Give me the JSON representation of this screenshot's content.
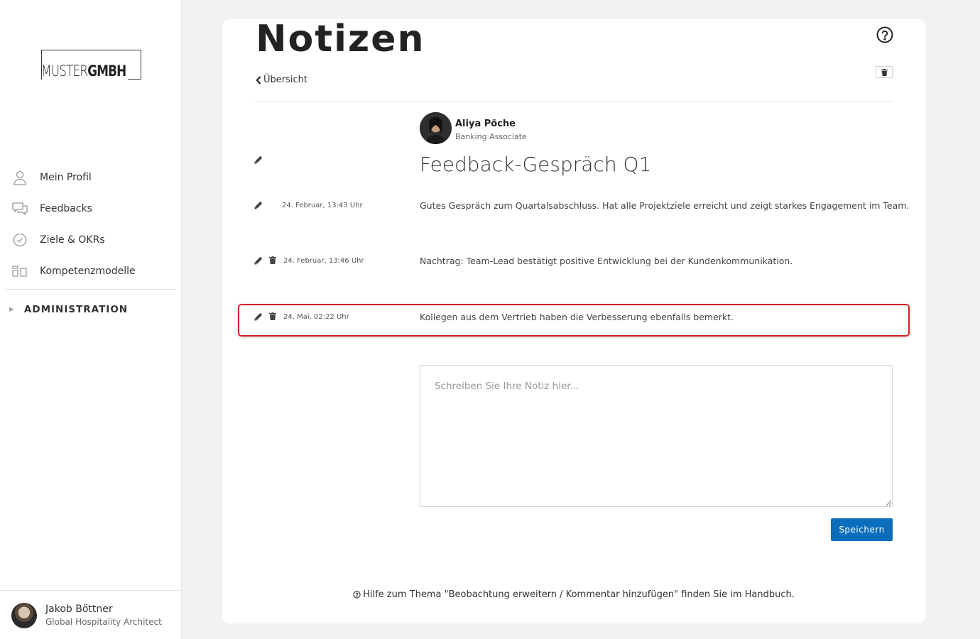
{
  "brand": {
    "logo_part1": "MUSTER",
    "logo_part2": "GMBH"
  },
  "sidebar": {
    "items": [
      {
        "label": "Mein Profil",
        "icon": "user-icon"
      },
      {
        "label": "Feedbacks",
        "icon": "chat-icon"
      },
      {
        "label": "Ziele & OKRs",
        "icon": "check-circle-icon"
      },
      {
        "label": "Kompetenzmodelle",
        "icon": "blocks-icon"
      }
    ],
    "admin_label": "ADMINISTRATION"
  },
  "current_user": {
    "name": "Jakob Böttner",
    "role": "Global Hospitality Architect"
  },
  "page": {
    "title": "Notizen",
    "back_label": "Übersicht"
  },
  "person": {
    "name": "Aliya Pöche",
    "role": "Banking Associate"
  },
  "note": {
    "title": "Feedback-Gespräch Q1",
    "entries": [
      {
        "date": "24. Februar, 13:43 Uhr",
        "text": "Gutes Gespräch zum Quartalsabschluss. Hat alle Projektziele erreicht und zeigt starkes Engagement im Team.",
        "deletable": false
      },
      {
        "date": "24. Februar, 13:46 Uhr",
        "text": "Nachtrag: Team-Lead bestätigt positive Entwicklung bei der Kundenkommunikation.",
        "deletable": true
      },
      {
        "date": "24. Mai, 02:22 Uhr",
        "text": "Kollegen aus dem Vertrieb haben die Verbesserung ebenfalls bemerkt.",
        "deletable": true
      }
    ]
  },
  "editor": {
    "placeholder": "Schreiben Sie Ihre Notiz hier...",
    "save_label": "Speichern"
  },
  "footer": {
    "help_text": "Hilfe zum Thema \"Beobachtung erweitern / Kommentar hinzufügen\" finden Sie im Handbuch."
  },
  "colors": {
    "primary": "#0a6ebd",
    "highlight": "#d0212a"
  }
}
